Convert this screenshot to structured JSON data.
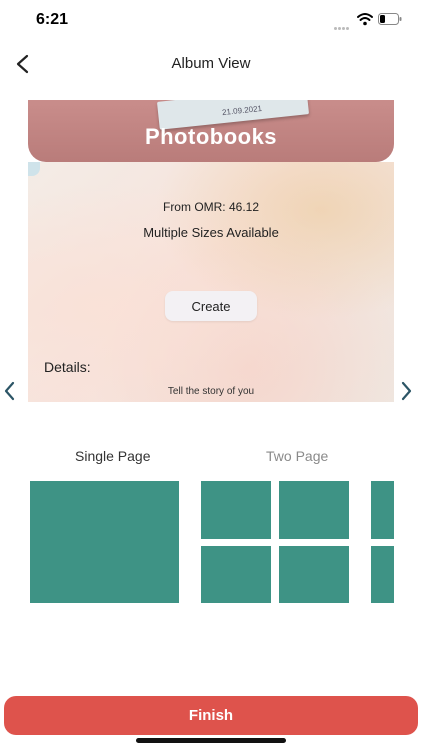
{
  "status_bar": {
    "time": "6:21"
  },
  "nav": {
    "title": "Album View"
  },
  "hero": {
    "title": "Photobooks",
    "book_date": "21.09.2021",
    "price_label": "From OMR:  46.12",
    "sizes": "Multiple Sizes Available",
    "create_label": "Create",
    "details_label": "Details:",
    "tagline": "Tell the story of you"
  },
  "layout_options": {
    "single": "Single Page",
    "two": "Two Page"
  },
  "footer": {
    "finish_label": "Finish"
  },
  "colors": {
    "accent": "#de534c",
    "tile": "#3e9385",
    "hero_band": "#c48a88"
  }
}
